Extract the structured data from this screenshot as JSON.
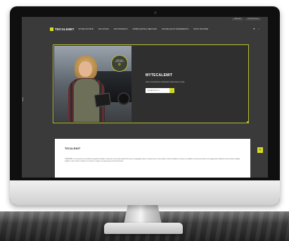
{
  "topbar": {
    "links": [
      "FRANÇAIS",
      "DISTRIBUTEURS"
    ]
  },
  "header": {
    "logo_text": "TECALEMIT",
    "nav": [
      "NOTRE SOCIÉTÉ",
      "SOLUTIONS",
      "NOS PRODUITS",
      "APRÈS-VENTE & SERVICES",
      "NOUVELLES ET ÉVÉNEMENTS",
      "NOUS TROUVER"
    ],
    "icons": [
      "flag-icon",
      "search-icon"
    ]
  },
  "hero": {
    "badge_text": "SERVICES INTELLIGENTS",
    "badge_icon": "truck-icon",
    "title": "MYTECALEMIT",
    "description": "Gérez vos données et démarrez votre mise en route",
    "cta_label": "EN SAVOIR PLUS",
    "cta_icon": "arrow-right-icon"
  },
  "intro": {
    "title": "TECALEMIT",
    "text": "TECALEMIT est un fournisseur de solutions de gestion de fluides, innovantes et de haute qualité. Nous vous accompagnons dans le monde entier en vous aidant à stocker, distribuer et mesurer vos fluides en toute sécurité. Avec nos équipements, bénéficiez d'une solution complète adaptée à votre activité, conforme aux normes en vigueur et respectueuse de l'environnement."
  },
  "side_button": {
    "icon": "plus-icon"
  },
  "colors": {
    "accent": "#d4de24",
    "screen_bg": "#3a3a3a",
    "card_bg": "#ffffff",
    "bezel": "#0f0f0f"
  }
}
